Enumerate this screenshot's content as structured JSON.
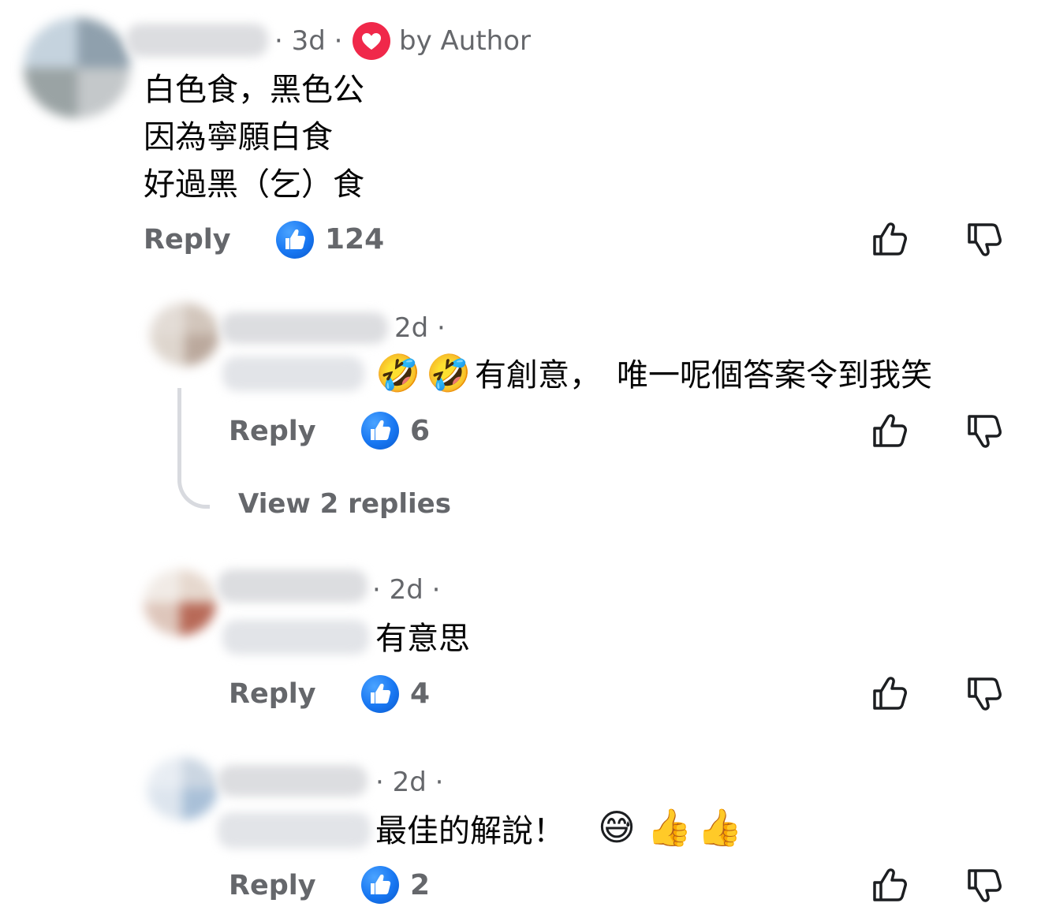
{
  "comments": [
    {
      "time": "· 3d ·",
      "author_badge": "by Author",
      "author_badge_icon": "heart-icon",
      "lines": [
        "白色食，黑色公",
        "因為寧願白食",
        "好過黑（乞）食"
      ],
      "reply_label": "Reply",
      "like_count": "124"
    },
    {
      "time": "2d ·",
      "text": "有創意，　唯一呢個答案令到我笑",
      "emojis": [
        "🤣",
        "🤣"
      ],
      "reply_label": "Reply",
      "like_count": "6",
      "view_replies": "View 2 replies"
    },
    {
      "time": "· 2d ·",
      "text": "有意思",
      "reply_label": "Reply",
      "like_count": "4"
    },
    {
      "time": "· 2d ·",
      "text": "最佳的解說！",
      "emojis": [
        "😅",
        "👍",
        "👍"
      ],
      "reply_label": "Reply",
      "like_count": "2"
    }
  ],
  "icons": {
    "like": "thumbs-up-icon",
    "dislike": "thumbs-down-icon",
    "reaction": "like-reaction-icon"
  },
  "colors": {
    "meta_gray": "#65676b",
    "like_blue": "#1877f2",
    "heart_red": "#f0284a"
  }
}
